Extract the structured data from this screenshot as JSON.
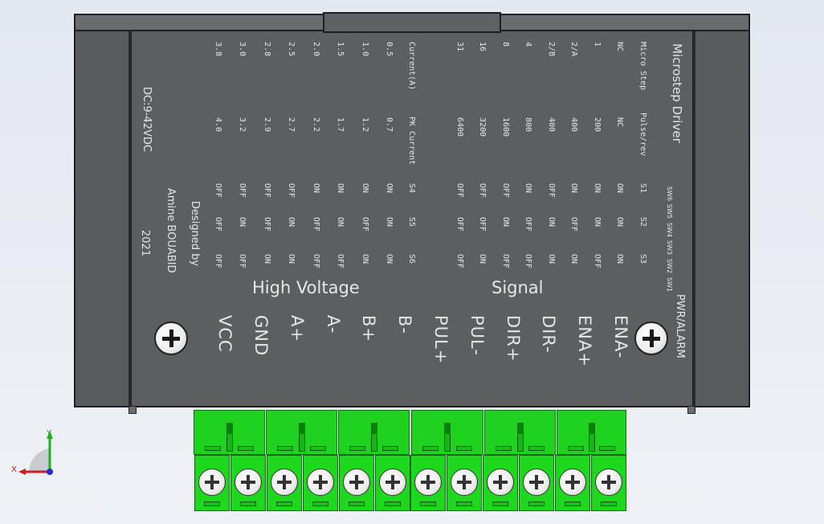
{
  "driver": {
    "title": "Microstep Driver",
    "pwr_alarm": "PWR/ALARM",
    "micro_step_header": [
      "Micro Step",
      "Pulse/rev",
      "S1",
      "S2",
      "S3"
    ],
    "micro_step_rows": [
      {
        "step": "NC",
        "pulse": "NC",
        "s1": "ON",
        "s2": "ON",
        "s3": "ON"
      },
      {
        "step": "1",
        "pulse": "200",
        "s1": "ON",
        "s2": "ON",
        "s3": "OFF"
      },
      {
        "step": "2/A",
        "pulse": "400",
        "s1": "ON",
        "s2": "OFF",
        "s3": "ON"
      },
      {
        "step": "2/B",
        "pulse": "400",
        "s1": "OFF",
        "s2": "ON",
        "s3": "ON"
      },
      {
        "step": "4",
        "pulse": "800",
        "s1": "ON",
        "s2": "OFF",
        "s3": "OFF"
      },
      {
        "step": "8",
        "pulse": "1600",
        "s1": "OFF",
        "s2": "ON",
        "s3": "OFF"
      },
      {
        "step": "16",
        "pulse": "3200",
        "s1": "OFF",
        "s2": "OFF",
        "s3": "ON"
      },
      {
        "step": "31",
        "pulse": "6400",
        "s1": "OFF",
        "s2": "OFF",
        "s3": "OFF"
      }
    ],
    "current_header": [
      "Current(A)",
      "PK Current",
      "S4",
      "S5",
      "S6"
    ],
    "current_rows": [
      {
        "cur": "0.5",
        "pk": "0.7",
        "s4": "ON",
        "s5": "ON",
        "s6": "ON"
      },
      {
        "cur": "1.0",
        "pk": "1.2",
        "s4": "ON",
        "s5": "OFF",
        "s6": "ON"
      },
      {
        "cur": "1.5",
        "pk": "1.7",
        "s4": "ON",
        "s5": "ON",
        "s6": "OFF"
      },
      {
        "cur": "2.0",
        "pk": "2.2",
        "s4": "ON",
        "s5": "OFF",
        "s6": "OFF"
      },
      {
        "cur": "2.5",
        "pk": "2.7",
        "s4": "OFF",
        "s5": "ON",
        "s6": "ON"
      },
      {
        "cur": "2.8",
        "pk": "2.9",
        "s4": "OFF",
        "s5": "OFF",
        "s6": "ON"
      },
      {
        "cur": "3.0",
        "pk": "3.2",
        "s4": "OFF",
        "s5": "ON",
        "s6": "OFF"
      },
      {
        "cur": "3.8",
        "pk": "4.0",
        "s4": "OFF",
        "s5": "OFF",
        "s6": "OFF"
      }
    ],
    "sw_labels": [
      "SW6",
      "SW5",
      "SW4",
      "SW3",
      "SW2",
      "SW1"
    ],
    "section_high_voltage": "High Voltage",
    "section_signal": "Signal",
    "pins": [
      "ENA-",
      "ENA+",
      "DIR-",
      "DIR+",
      "PUL-",
      "PUL+",
      "B-",
      "B+",
      "A-",
      "A+",
      "GND",
      "VCC"
    ],
    "designed_by": "Designed by",
    "designer": "Amine BOUABID",
    "year": "2021",
    "voltage": "DC:9-42VDC"
  },
  "axes": {
    "x": "X",
    "y": "Y"
  },
  "colors": {
    "housing": "#5d5e5f",
    "terminal": "#1fd21f",
    "background": "#e9ecf1"
  }
}
